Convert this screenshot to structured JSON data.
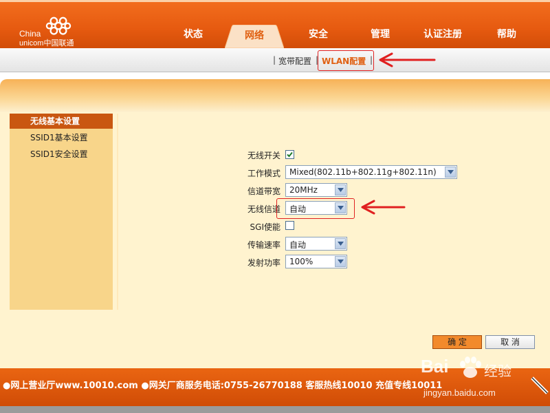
{
  "brand": {
    "line1": "China",
    "line2": "unicom中国联通"
  },
  "nav": {
    "items": [
      "状态",
      "网络",
      "安全",
      "管理",
      "认证注册",
      "帮助"
    ],
    "active": "网络"
  },
  "subnav": {
    "sep": "|",
    "broadband": "宽带配置",
    "wlan": "WLAN配置"
  },
  "sidebar": {
    "items": [
      "无线基本设置",
      "SSID1基本设置",
      "SSID1安全设置"
    ]
  },
  "form": {
    "wireless_switch": {
      "label": "无线开关",
      "checked": true
    },
    "mode": {
      "label": "工作模式",
      "value": "Mixed(802.11b+802.11g+802.11n)"
    },
    "bandwidth": {
      "label": "信道带宽",
      "value": "20MHz"
    },
    "channel": {
      "label": "无线信道",
      "value": "自动"
    },
    "sgi": {
      "label": "SGI使能",
      "checked": false
    },
    "rate": {
      "label": "传输速率",
      "value": "自动"
    },
    "power": {
      "label": "发射功率",
      "value": "100%"
    }
  },
  "buttons": {
    "ok": "确 定",
    "cancel": "取 消"
  },
  "footer": {
    "text": "●网上营业厅www.10010.com ●网关厂商服务电话:0755-26770188 客服热线10010 充值专线10011"
  },
  "watermark": {
    "brand": "Bai",
    "cn": "经验",
    "url": "jingyan.baidu.com"
  },
  "colors": {
    "accent": "#e65a10",
    "sidebar": "#f8d58a",
    "annotation": "#e02020"
  }
}
